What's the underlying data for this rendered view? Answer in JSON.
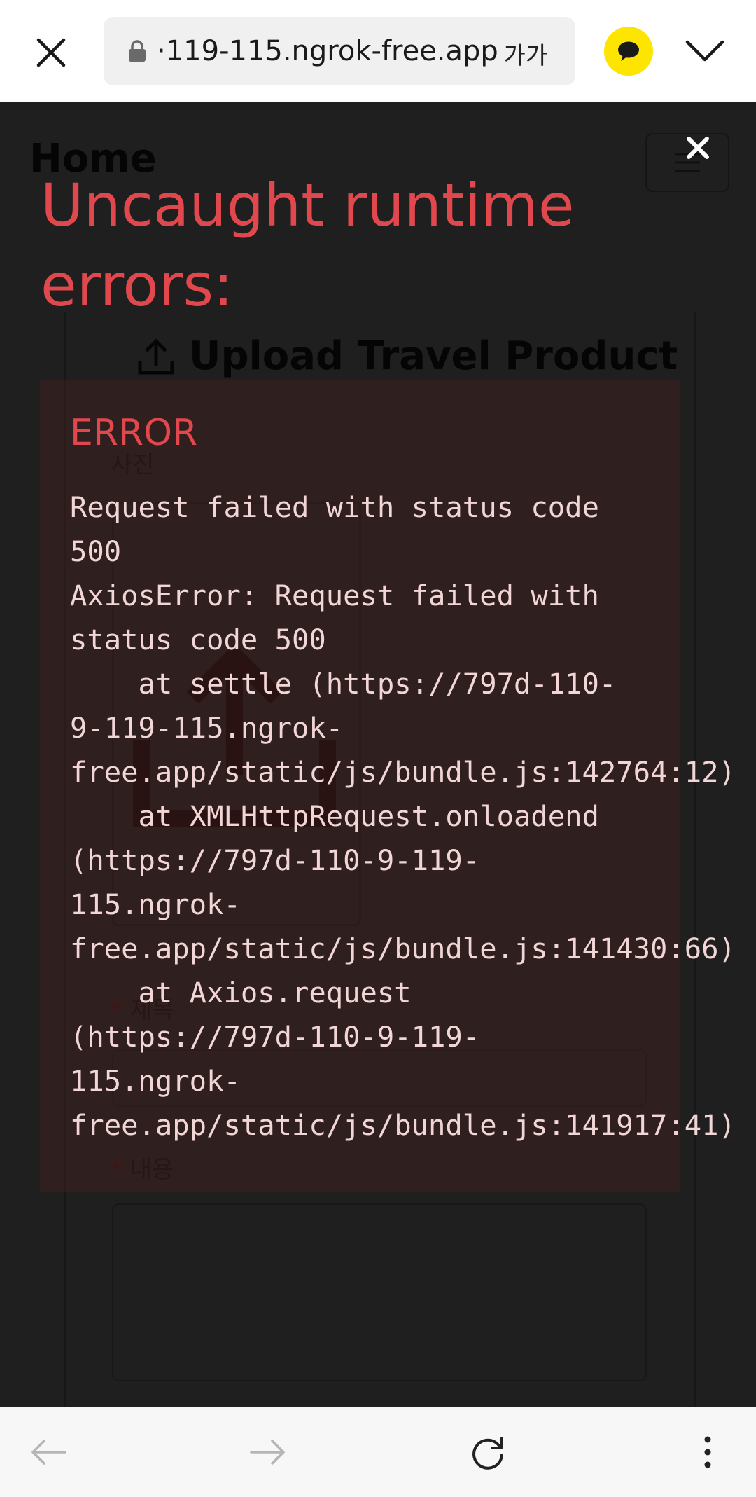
{
  "browser": {
    "url": "·119-115.ngrok-free.app",
    "text_size_label": "가가",
    "icons": [
      "close-icon",
      "lock-icon",
      "kakao-talk-icon",
      "chevron-down-icon",
      "back-icon",
      "forward-icon",
      "refresh-icon",
      "more-icon"
    ]
  },
  "page": {
    "header_title": "Home",
    "upload_title": "Upload Travel Product",
    "photo_label": "사진",
    "title_label": "제목",
    "content_label": "내용",
    "required_mark": "*"
  },
  "overlay": {
    "close_glyph": "✕",
    "title": "Uncaught runtime errors:",
    "error_label": "ERROR",
    "error_lines": [
      "Request failed with status code",
      "500",
      "AxiosError: Request failed with",
      "status code 500",
      "    at settle (https://797d-110-",
      "9-119-115.ngrok-",
      "free.app/static/js/bundle.js:142764:12)",
      "    at XMLHttpRequest.onloadend",
      "(https://797d-110-9-119-",
      "115.ngrok-",
      "free.app/static/js/bundle.js:141430:66)",
      "    at Axios.request",
      "(https://797d-110-9-119-",
      "115.ngrok-",
      "free.app/static/js/bundle.js:141917:41)"
    ]
  },
  "colors": {
    "error_red": "#e0484d",
    "overlay_bg": "#1f1f1f",
    "kakao_yellow": "#fee500"
  }
}
